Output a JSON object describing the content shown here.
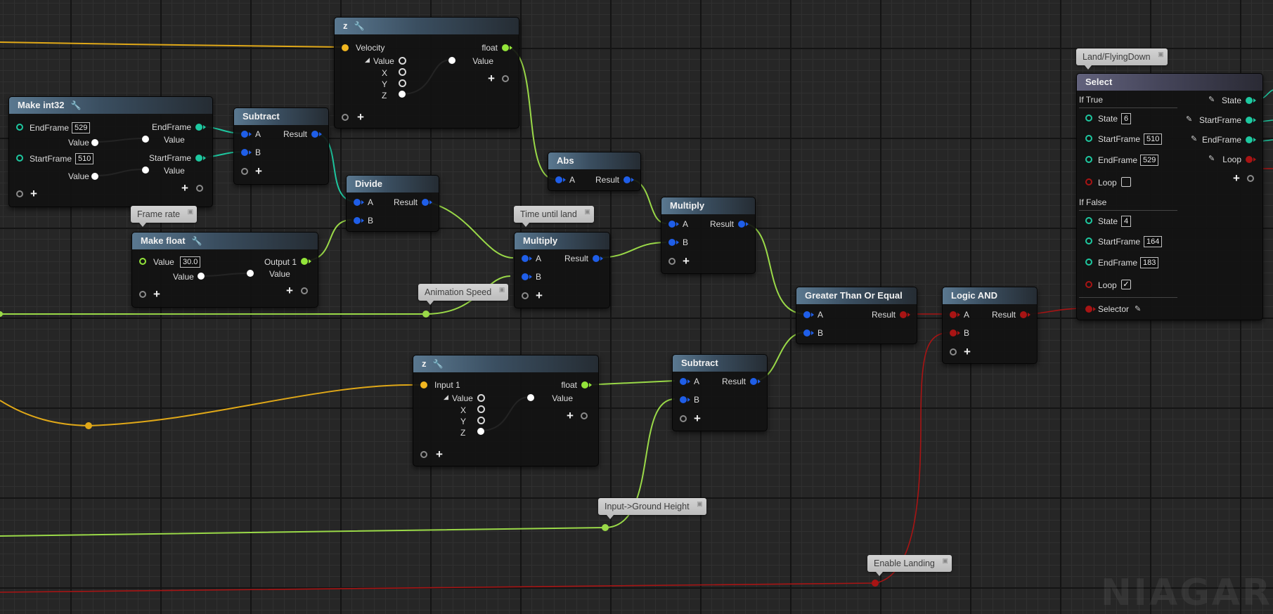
{
  "colors": {
    "float_wire": "#9ad948",
    "vector_wire": "#e0a818",
    "int_wire": "#1ec8a0",
    "bool_wire": "#a81414",
    "numeric_pin": "#1f5ee8"
  },
  "icons": [
    "wrench-icon",
    "add-pin-icon",
    "pencil-icon",
    "checkbox-icon",
    "comment-pin-icon",
    "expand-arrow-icon"
  ],
  "nodes": {
    "z_velocity": {
      "title": "z",
      "in": "Velocity",
      "out": "float",
      "value_label": "Value",
      "x": "X",
      "y": "Y",
      "z": "Z",
      "out_value": "Value"
    },
    "make_int32": {
      "title": "Make int32",
      "endframe": "EndFrame",
      "endframe_val": "529",
      "startframe": "StartFrame",
      "startframe_val": "510",
      "value": "Value",
      "out_end": "EndFrame",
      "out_start": "StartFrame"
    },
    "subtract1": {
      "title": "Subtract",
      "a": "A",
      "b": "B",
      "result": "Result"
    },
    "divide": {
      "title": "Divide",
      "a": "A",
      "b": "B",
      "result": "Result"
    },
    "make_float": {
      "title": "Make float",
      "value": "Value",
      "value_val": "30.0",
      "output": "Output 1",
      "sub_value": "Value"
    },
    "abs": {
      "title": "Abs",
      "a": "A",
      "result": "Result"
    },
    "multiply1": {
      "title": "Multiply",
      "a": "A",
      "b": "B",
      "result": "Result"
    },
    "multiply2": {
      "title": "Multiply",
      "a": "A",
      "b": "B",
      "result": "Result"
    },
    "gte": {
      "title": "Greater Than Or Equal",
      "a": "A",
      "b": "B",
      "result": "Result"
    },
    "logic_and": {
      "title": "Logic AND",
      "a": "A",
      "b": "B",
      "result": "Result"
    },
    "z_input": {
      "title": "z",
      "in": "Input 1",
      "out": "float",
      "value_label": "Value",
      "x": "X",
      "y": "Y",
      "z": "Z",
      "out_value": "Value"
    },
    "subtract2": {
      "title": "Subtract",
      "a": "A",
      "b": "B",
      "result": "Result"
    },
    "select": {
      "title": "Select",
      "if_true": "If True",
      "if_false": "If False",
      "state": "State",
      "startframe": "StartFrame",
      "endframe": "EndFrame",
      "loop": "Loop",
      "selector": "Selector",
      "true_state": "6",
      "true_start": "510",
      "true_end": "529",
      "true_loop": false,
      "false_state": "4",
      "false_start": "164",
      "false_end": "183",
      "false_loop": true
    }
  },
  "comments": {
    "frame_rate": "Frame rate",
    "time_until_land": "Time until land",
    "animation_speed": "Animation Speed",
    "input_ground_height": "Input->Ground Height",
    "enable_landing": "Enable Landing",
    "land_flying_down": "Land/FlyingDown"
  },
  "watermark": "NIAGARA"
}
